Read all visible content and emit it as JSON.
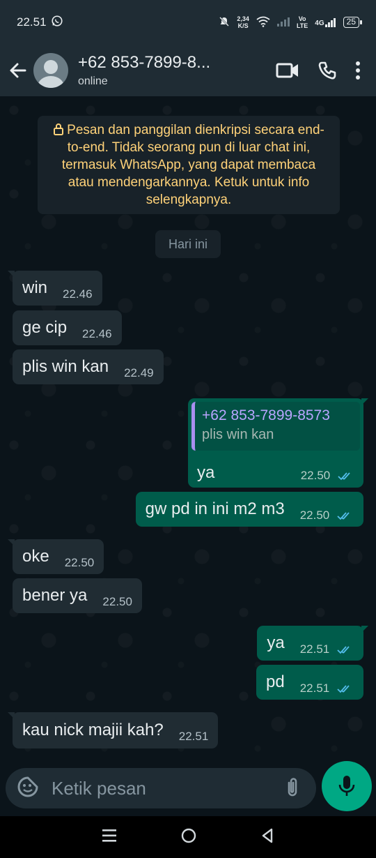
{
  "status_bar": {
    "time": "22.51",
    "speed_value": "2,34",
    "speed_unit": "K/S",
    "network_top": "Vo",
    "network_bottom": "LTE",
    "network_gen": "4G",
    "battery": "25"
  },
  "header": {
    "contact_name": "+62 853-7899-8...",
    "contact_status": "online"
  },
  "encryption_notice": "Pesan dan panggilan dienkripsi secara end-to-end. Tidak seorang pun di luar chat ini, termasuk WhatsApp, yang dapat membaca atau mendengarkannya. Ketuk untuk info selengkapnya.",
  "day_separator": "Hari ini",
  "messages": [
    {
      "dir": "in",
      "text": "win",
      "time": "22.46"
    },
    {
      "dir": "in",
      "text": "ge cip",
      "time": "22.46"
    },
    {
      "dir": "in",
      "text": "plis win kan",
      "time": "22.49"
    },
    {
      "dir": "out",
      "text": "ya",
      "time": "22.50",
      "reply_to_name": "+62 853-7899-8573",
      "reply_to_text": "plis win kan"
    },
    {
      "dir": "out",
      "text": "gw pd in ini m2 m3",
      "time": "22.50"
    },
    {
      "dir": "in",
      "text": "oke",
      "time": "22.50"
    },
    {
      "dir": "in",
      "text": "bener ya",
      "time": "22.50"
    },
    {
      "dir": "out",
      "text": "ya",
      "time": "22.51"
    },
    {
      "dir": "out",
      "text": "pd",
      "time": "22.51"
    },
    {
      "dir": "in",
      "text": "kau nick majii kah?",
      "time": "22.51"
    }
  ],
  "composer": {
    "placeholder": "Ketik pesan"
  },
  "colors": {
    "incoming_bubble": "#202c33",
    "outgoing_bubble": "#005c4b",
    "accent": "#00a884",
    "read_ticks": "#53bdeb",
    "encryption_text": "#ffd279"
  }
}
